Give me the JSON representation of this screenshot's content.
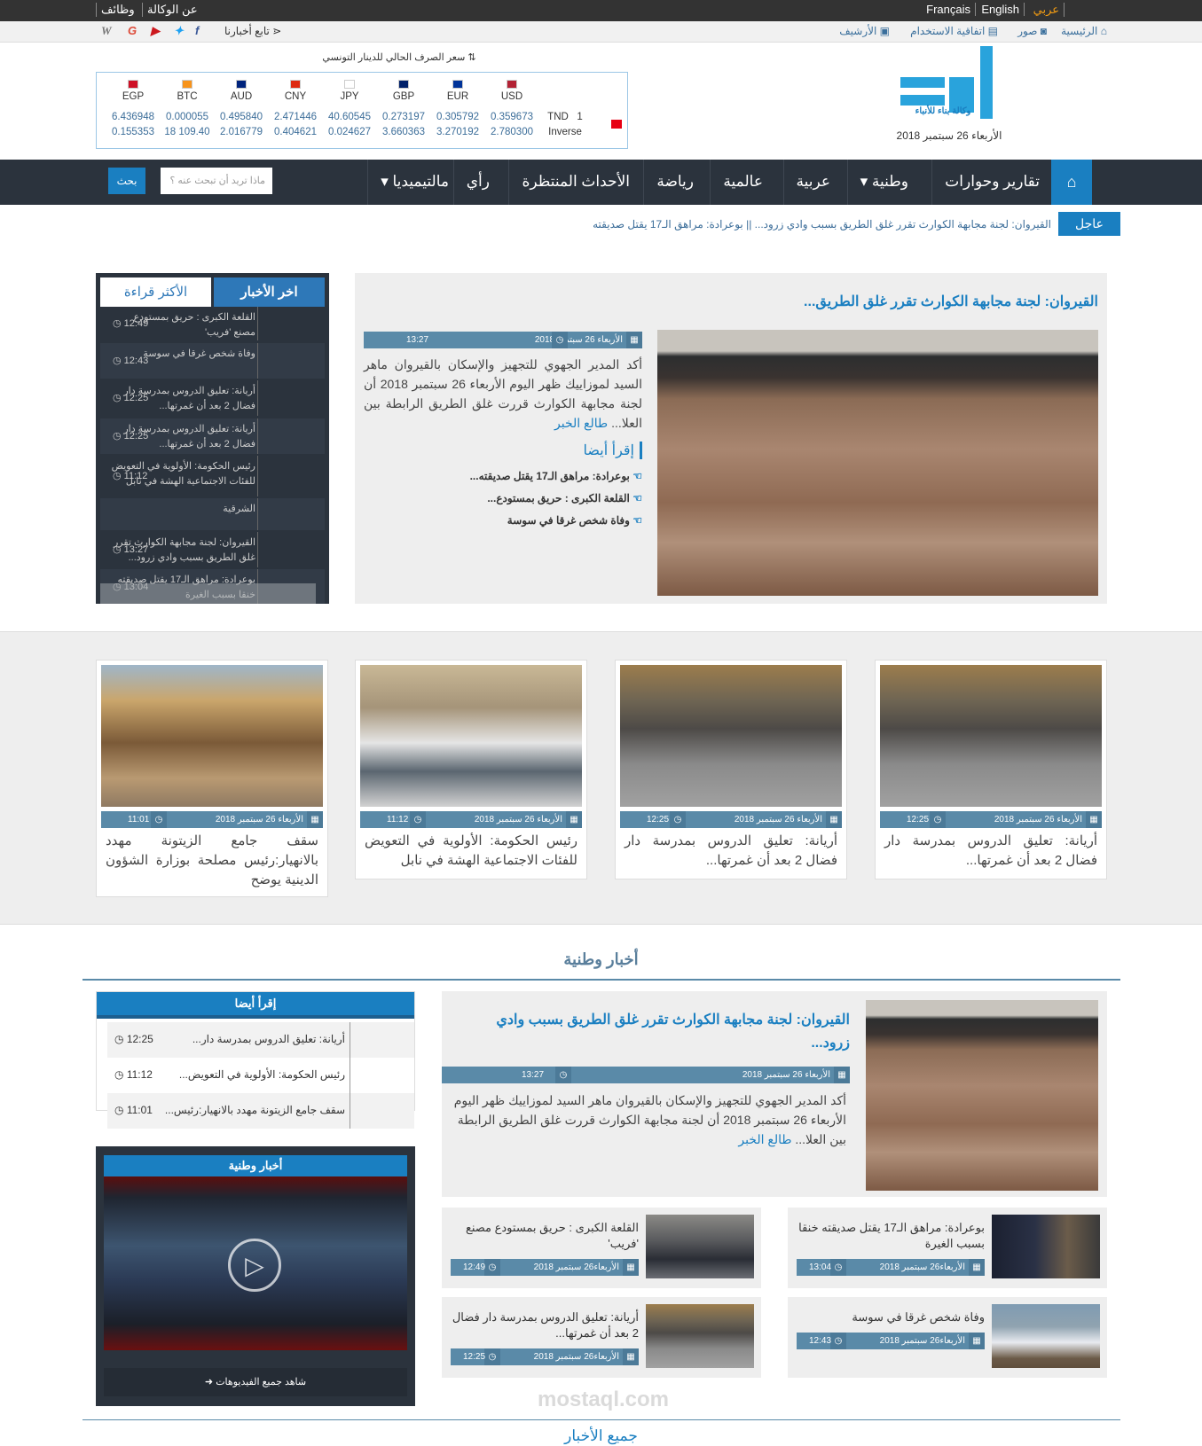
{
  "topbar": {
    "lang_ar": "عربي",
    "lang_en": "English",
    "lang_fr": "Français",
    "about": "عن الوكالة",
    "jobs": "وظائف"
  },
  "subbar": {
    "home": "الرئيسية",
    "photos": "صور",
    "terms": "اتفاقية الاستخدام",
    "archive": "الأرشيف",
    "follow": "تابع أخبارنا",
    "social": [
      "facebook-icon",
      "twitter-icon",
      "youtube-icon",
      "google-icon",
      "wikipedia-icon"
    ]
  },
  "logo": {
    "text": "وكالة بناء للأنباء",
    "date": "الأربعاء 26 سبتمبر 2018"
  },
  "currency": {
    "title": "سعر الصرف الحالي للدينار التونسي",
    "codes": [
      "USD",
      "EUR",
      "GBP",
      "JPY",
      "CNY",
      "AUD",
      "BTC",
      "EGP"
    ],
    "base": "TND",
    "base_value": "1",
    "inverse_label": "Inverse",
    "rates": [
      "0.359673",
      "0.305792",
      "0.273197",
      "40.60545",
      "2.471446",
      "0.495840",
      "0.000055",
      "6.436948"
    ],
    "inverse": [
      "2.780300",
      "3.270192",
      "3.660363",
      "0.024627",
      "0.404621",
      "2.016779",
      "109.40 18",
      "0.155353"
    ]
  },
  "nav": {
    "items": [
      "تقارير وحوارات",
      "وطنية",
      "عربية",
      "عالمية",
      "رياضة",
      "الأحداث المنتظرة",
      "رأي",
      "مالتيميديا"
    ],
    "search_placeholder": "ماذا تريد أن تبحث عنه ؟",
    "search_button": "بحث"
  },
  "ticker": {
    "label": "عاجل",
    "text": "القيروان: لجنة مجابهة الكوارث تقرر غلق الطريق بسبب وادي زرود...   ||  بوعرادة: مراهق الـ17 يقتل صديقته"
  },
  "sidebar": {
    "tab_latest": "اخر الأخبار",
    "tab_most_read": "الأكثر قراءة",
    "items": [
      {
        "time": "12:49",
        "title": "القلعة الكبرى : حريق بمستودع مصنع 'فريب'"
      },
      {
        "time": "12:43",
        "title": "وفاة شخص غرقا في سوسة"
      },
      {
        "time": "12:25",
        "title": "أريانة: تعليق الدروس بمدرسة دار فضال 2 بعد أن غمرتها..."
      },
      {
        "time": "12:25",
        "title": "أريانة: تعليق الدروس بمدرسة دار فضال 2 بعد أن غمرتها..."
      },
      {
        "time": "11:12",
        "title": "رئيس الحكومة: الأولوية في التعويض للفئات الاجتماعية الهشة في نابل"
      },
      {
        "time": "",
        "title": "الشرقية"
      },
      {
        "time": "13:27",
        "title": "القيروان: لجنة مجابهة الكوارث تقرر غلق الطريق بسبب وادي زرود..."
      },
      {
        "time": "13:04",
        "title": "بوعرادة: مراهق الـ17 يقتل صديقته خنقا بسبب الغيرة"
      }
    ]
  },
  "featured": {
    "title": "القيروان: لجنة مجابهة الكوارث تقرر غلق الطريق...",
    "date": "الأربعاء 26 سبتمبر 2018",
    "time": "13:27",
    "body": "أكد المدير الجهوي للتجهيز والإسكان بالقيروان ماهر السيد لموزاييك ظهر اليوم الأربعاء 26 سبتمبر 2018 أن لجنة مجابهة الكوارث قررت غلق الطريق الرابطة بين العلا...",
    "more": "طالع الخبر",
    "read_also": "إقرأ أيضا",
    "related": [
      "بوعرادة: مراهق الـ17 يقتل صديقته...",
      "القلعة الكبرى : حريق بمستودع...",
      "وفاة شخص غرقا في سوسة"
    ]
  },
  "cards": [
    {
      "date": "الأربعاء 26 سبتمبر 2018",
      "time": "12:25",
      "title": "أريانة: تعليق الدروس بمدرسة دار فضال 2 بعد أن غمرتها...",
      "img": "kids"
    },
    {
      "date": "الأربعاء 26 سبتمبر 2018",
      "time": "12:25",
      "title": "أريانة: تعليق الدروس بمدرسة دار فضال 2 بعد أن غمرتها...",
      "img": "kids"
    },
    {
      "date": "الأربعاء 26 سبتمبر 2018",
      "time": "11:12",
      "title": "رئيس الحكومة: الأولوية في التعويض للفئات الاجتماعية الهشة في نابل",
      "img": "meet"
    },
    {
      "date": "الأربعاء 26 سبتمبر 2018",
      "time": "11:01",
      "title": "سقف جامع الزيتونة مهدد بالانهيار:رئيس مصلحة بوزارة الشؤون الدينية يوضح",
      "img": "mosque"
    }
  ],
  "national": {
    "heading": "أخبار وطنية",
    "read_also": "إقرأ أيضا",
    "list": [
      {
        "time": "12:25",
        "title": "أريانة: تعليق الدروس بمدرسة دار..."
      },
      {
        "time": "11:12",
        "title": "رئيس الحكومة: الأولوية في التعويض..."
      },
      {
        "time": "11:01",
        "title": "سقف جامع الزيتونة مهدد بالانهيار:رئيس..."
      }
    ],
    "video_heading": "أخبار وطنية",
    "video_link": "شاهد جميع الفيديوهات",
    "feature": {
      "title": "القيروان: لجنة مجابهة الكوارث تقرر غلق الطريق بسبب وادي زرود...",
      "date": "الأربعاء 26 سبتمبر 2018",
      "time": "13:27",
      "body": "أكد المدير الجهوي للتجهيز والإسكان بالقيروان ماهر السيد لموزاييك ظهر اليوم الأربعاء 26 سبتمبر 2018 أن لجنة مجابهة الكوارث قررت غلق الطريق الرابطة بين العلا...",
      "more": "طالع الخبر"
    },
    "small": [
      {
        "title": "بوعرادة: مراهق الـ17 يقتل صديقته خنقا بسبب الغيرة",
        "date": "الأربعاء26 سبتمبر 2018",
        "time": "13:04",
        "img": "rope"
      },
      {
        "title": "القلعة الكبرى : حريق بمستودع مصنع 'فريب'",
        "date": "الأربعاء26 سبتمبر 2018",
        "time": "12:49",
        "img": "fire"
      },
      {
        "title": "وفاة شخص غرقا في سوسة",
        "date": "الأربعاء26 سبتمبر 2018",
        "time": "12:43",
        "img": "beach"
      },
      {
        "title": "أريانة: تعليق الدروس بمدرسة دار فضال 2 بعد أن غمرتها...",
        "date": "الأربعاء26 سبتمبر 2018",
        "time": "12:25",
        "img": "kids"
      }
    ]
  },
  "all_news": "جميع الأخبار",
  "watermark": "mostaql.com",
  "colors": {
    "primary": "#1a7fc1",
    "dark": "#2b333d",
    "meta": "#5a8aa8",
    "accent": "#f39c12"
  }
}
